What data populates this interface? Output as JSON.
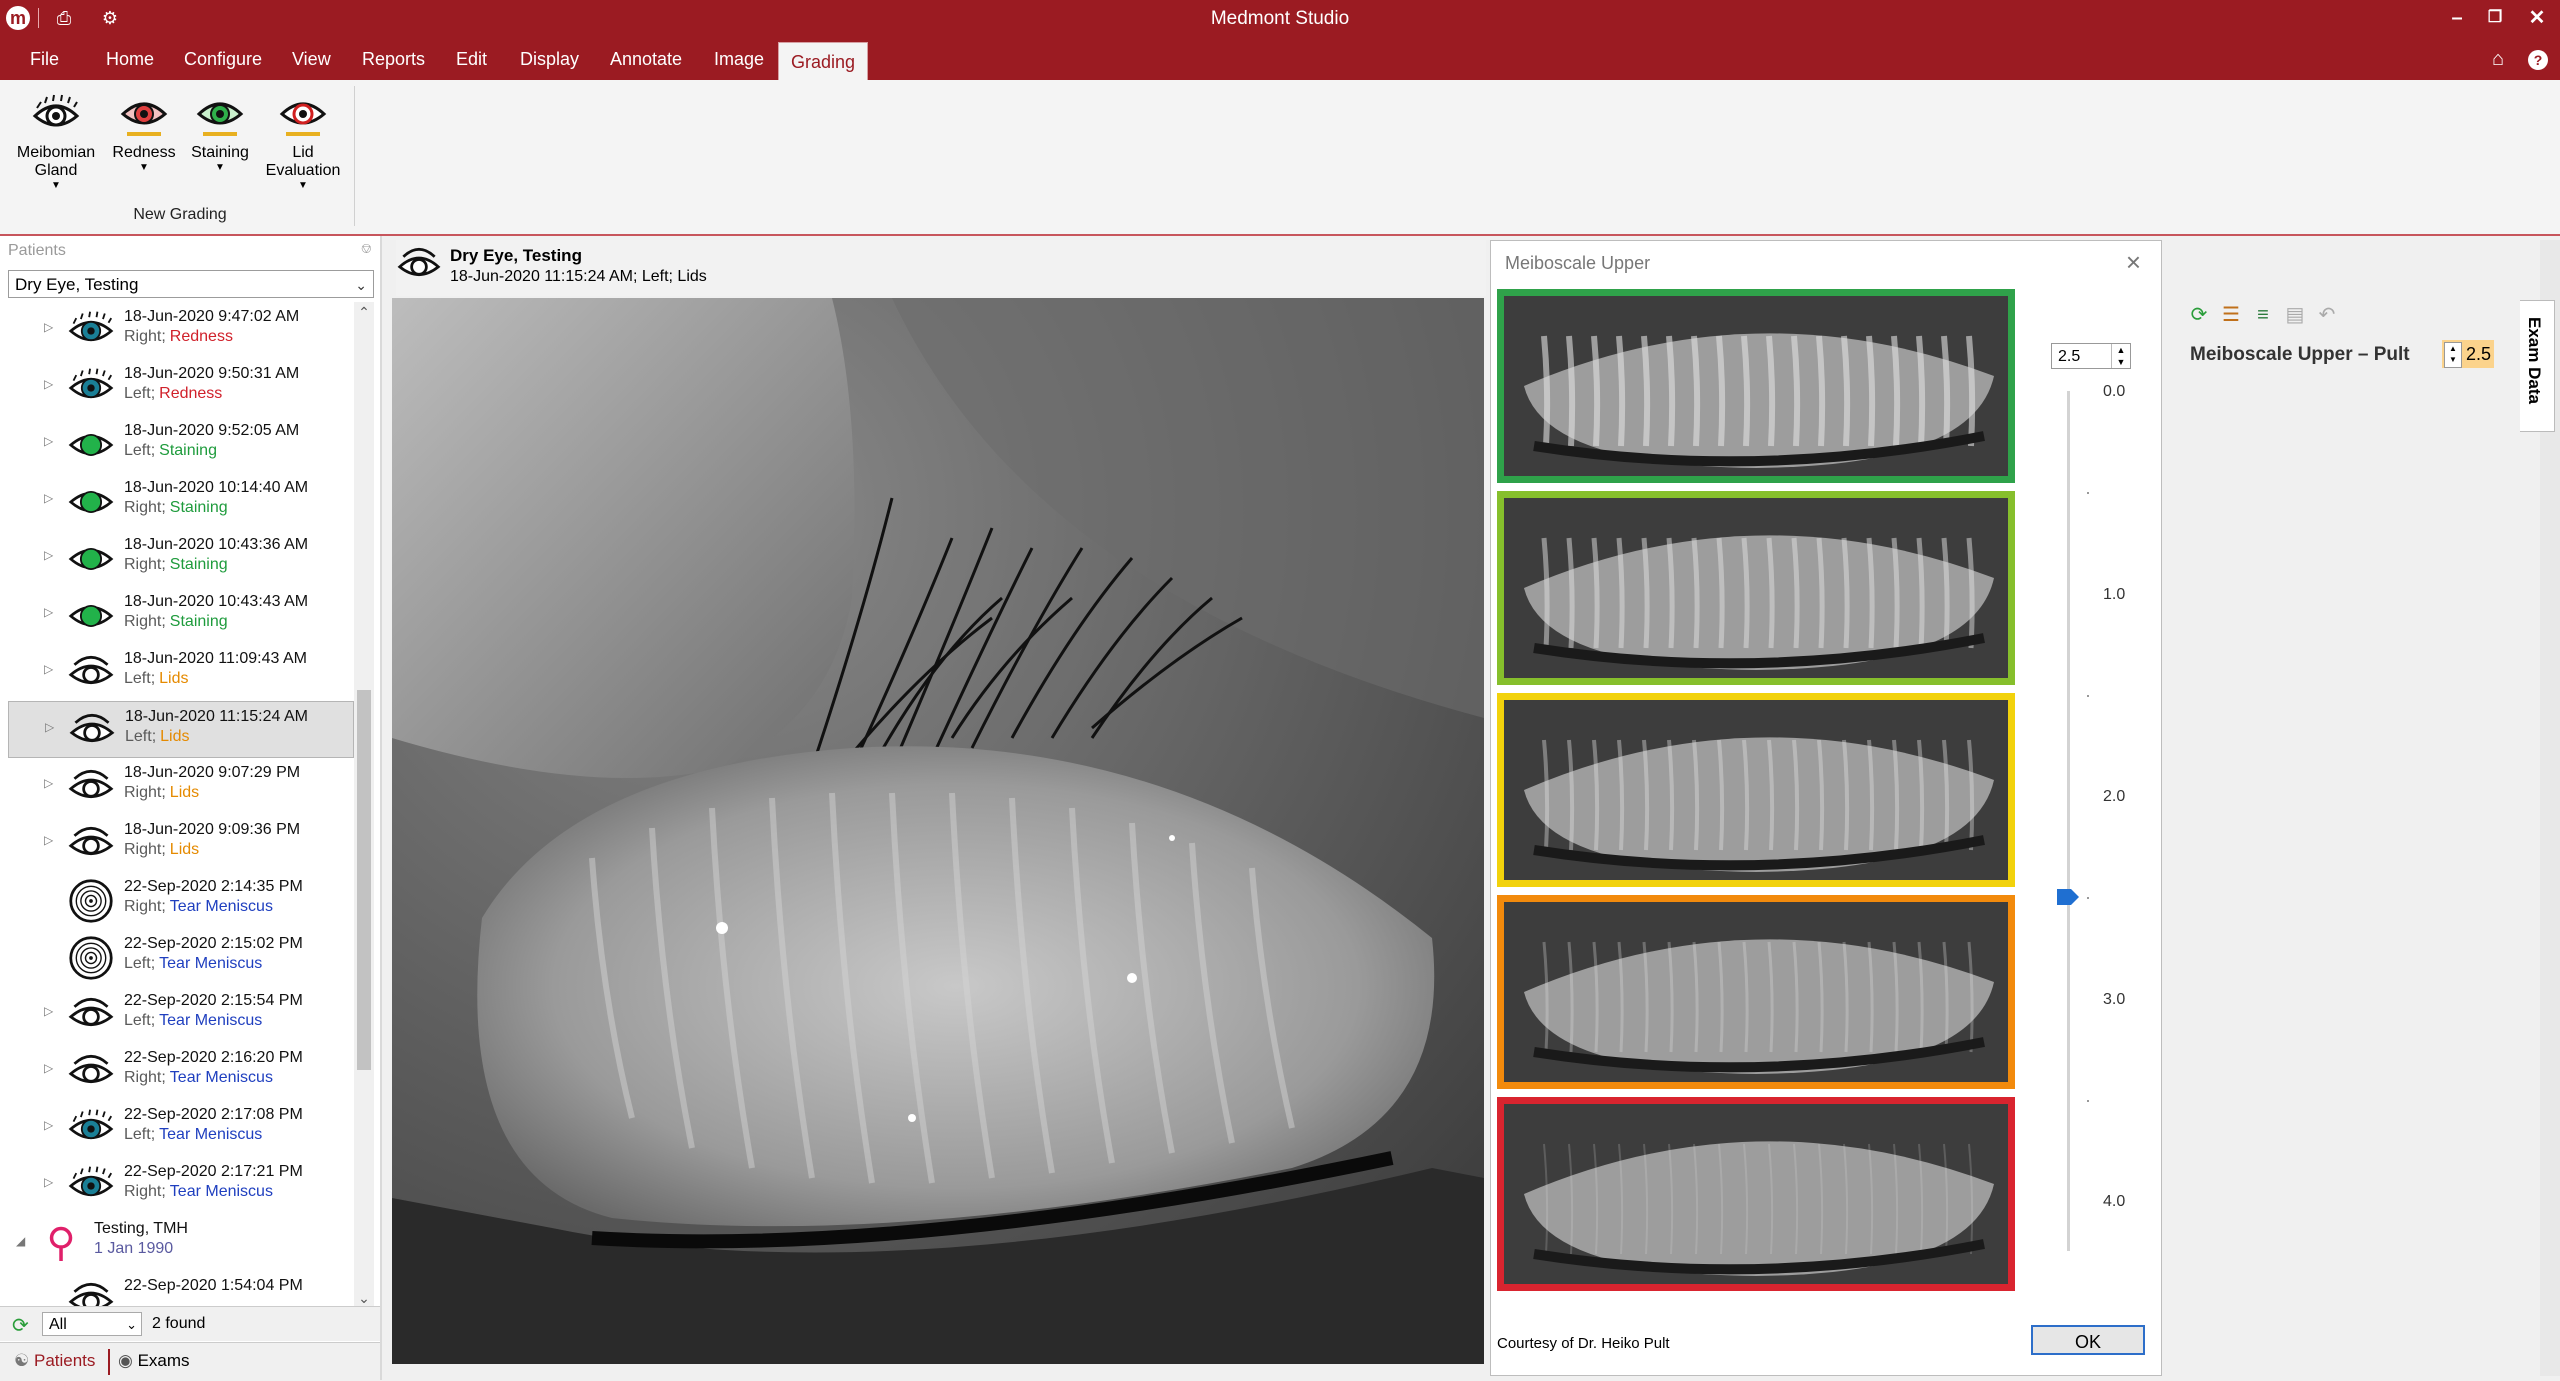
{
  "window": {
    "title": "Medmont Studio"
  },
  "menu": [
    "File",
    "Home",
    "Configure",
    "View",
    "Reports",
    "Edit",
    "Display",
    "Annotate",
    "Image",
    "Grading"
  ],
  "active_menu": "Grading",
  "ribbon": {
    "buttons": [
      {
        "label": "Meibomian Gland",
        "icon": "meibomian-eye-icon"
      },
      {
        "label": "Redness",
        "icon": "redness-eye-icon"
      },
      {
        "label": "Staining",
        "icon": "staining-eye-icon"
      },
      {
        "label": "Lid Evaluation",
        "icon": "lid-eye-icon"
      }
    ],
    "group_label": "New Grading"
  },
  "patients_panel": {
    "header": "Patients",
    "selected_patient": "Dry Eye, Testing",
    "exams": [
      {
        "date": "18-Jun-2020 9:47:02 AM",
        "side": "Right;",
        "type": "Redness",
        "kind": "redness",
        "type_color": "#d0212b"
      },
      {
        "date": "18-Jun-2020 9:50:31 AM",
        "side": "Left;",
        "type": "Redness",
        "kind": "redness",
        "type_color": "#d0212b"
      },
      {
        "date": "18-Jun-2020 9:52:05 AM",
        "side": "Left;",
        "type": "Staining",
        "kind": "staining",
        "type_color": "#1e9b3c"
      },
      {
        "date": "18-Jun-2020 10:14:40 AM",
        "side": "Right;",
        "type": "Staining",
        "kind": "staining",
        "type_color": "#1e9b3c"
      },
      {
        "date": "18-Jun-2020 10:43:36 AM",
        "side": "Right;",
        "type": "Staining",
        "kind": "staining",
        "type_color": "#1e9b3c"
      },
      {
        "date": "18-Jun-2020 10:43:43 AM",
        "side": "Right;",
        "type": "Staining",
        "kind": "staining",
        "type_color": "#1e9b3c"
      },
      {
        "date": "18-Jun-2020 11:09:43 AM",
        "side": "Left;",
        "type": "Lids",
        "kind": "lids",
        "type_color": "#e58a00"
      },
      {
        "date": "18-Jun-2020 11:15:24 AM",
        "side": "Left;",
        "type": "Lids",
        "kind": "lids",
        "type_color": "#e58a00"
      },
      {
        "date": "18-Jun-2020 9:07:29 PM",
        "side": "Right;",
        "type": "Lids",
        "kind": "lids",
        "type_color": "#e58a00"
      },
      {
        "date": "18-Jun-2020 9:09:36 PM",
        "side": "Right;",
        "type": "Lids",
        "kind": "lids",
        "type_color": "#e58a00"
      },
      {
        "date": "22-Sep-2020 2:14:35 PM",
        "side": "Right;",
        "type": "Tear Meniscus",
        "kind": "meniscus-rings",
        "type_color": "#1f3fbf"
      },
      {
        "date": "22-Sep-2020 2:15:02 PM",
        "side": "Left;",
        "type": "Tear Meniscus",
        "kind": "meniscus-rings",
        "type_color": "#1f3fbf"
      },
      {
        "date": "22-Sep-2020 2:15:54 PM",
        "side": "Left;",
        "type": "Tear Meniscus",
        "kind": "lids",
        "type_color": "#1f3fbf"
      },
      {
        "date": "22-Sep-2020 2:16:20 PM",
        "side": "Right;",
        "type": "Tear Meniscus",
        "kind": "lids",
        "type_color": "#1f3fbf"
      },
      {
        "date": "22-Sep-2020 2:17:08 PM",
        "side": "Left;",
        "type": "Tear Meniscus",
        "kind": "redness",
        "type_color": "#1f3fbf"
      },
      {
        "date": "22-Sep-2020 2:17:21 PM",
        "side": "Right;",
        "type": "Tear Meniscus",
        "kind": "redness",
        "type_color": "#1f3fbf"
      }
    ],
    "selected_exam_index": 7,
    "second_patient": {
      "name": "Testing, TMH",
      "dob": "1 Jan 1990"
    },
    "partial_exam": {
      "date": "22-Sep-2020 1:54:04 PM"
    },
    "filter_value": "All",
    "found": "2 found",
    "tabs": {
      "patients": "Patients",
      "exams": "Exams"
    }
  },
  "viewer": {
    "patient": "Dry Eye, Testing",
    "exam_info": "18-Jun-2020 11:15:24 AM; Left; Lids"
  },
  "dialog": {
    "title": "Meiboscale Upper",
    "grade_value": "2.5",
    "scale_ticks": [
      "0.0",
      "1.0",
      "2.0",
      "3.0",
      "4.0"
    ],
    "slider_level": 2.5,
    "slider_max": 4.0,
    "image_border_colors": [
      "#2fa24a",
      "#86bf2c",
      "#f2d20c",
      "#f28a0c",
      "#d9242f"
    ],
    "courtesy": "Courtesy of Dr. Heiko Pult",
    "ok_label": "OK"
  },
  "exam_data": {
    "field_label": "Meiboscale Upper – Pult",
    "field_value": "2.5",
    "side_tab": "Exam Data"
  }
}
